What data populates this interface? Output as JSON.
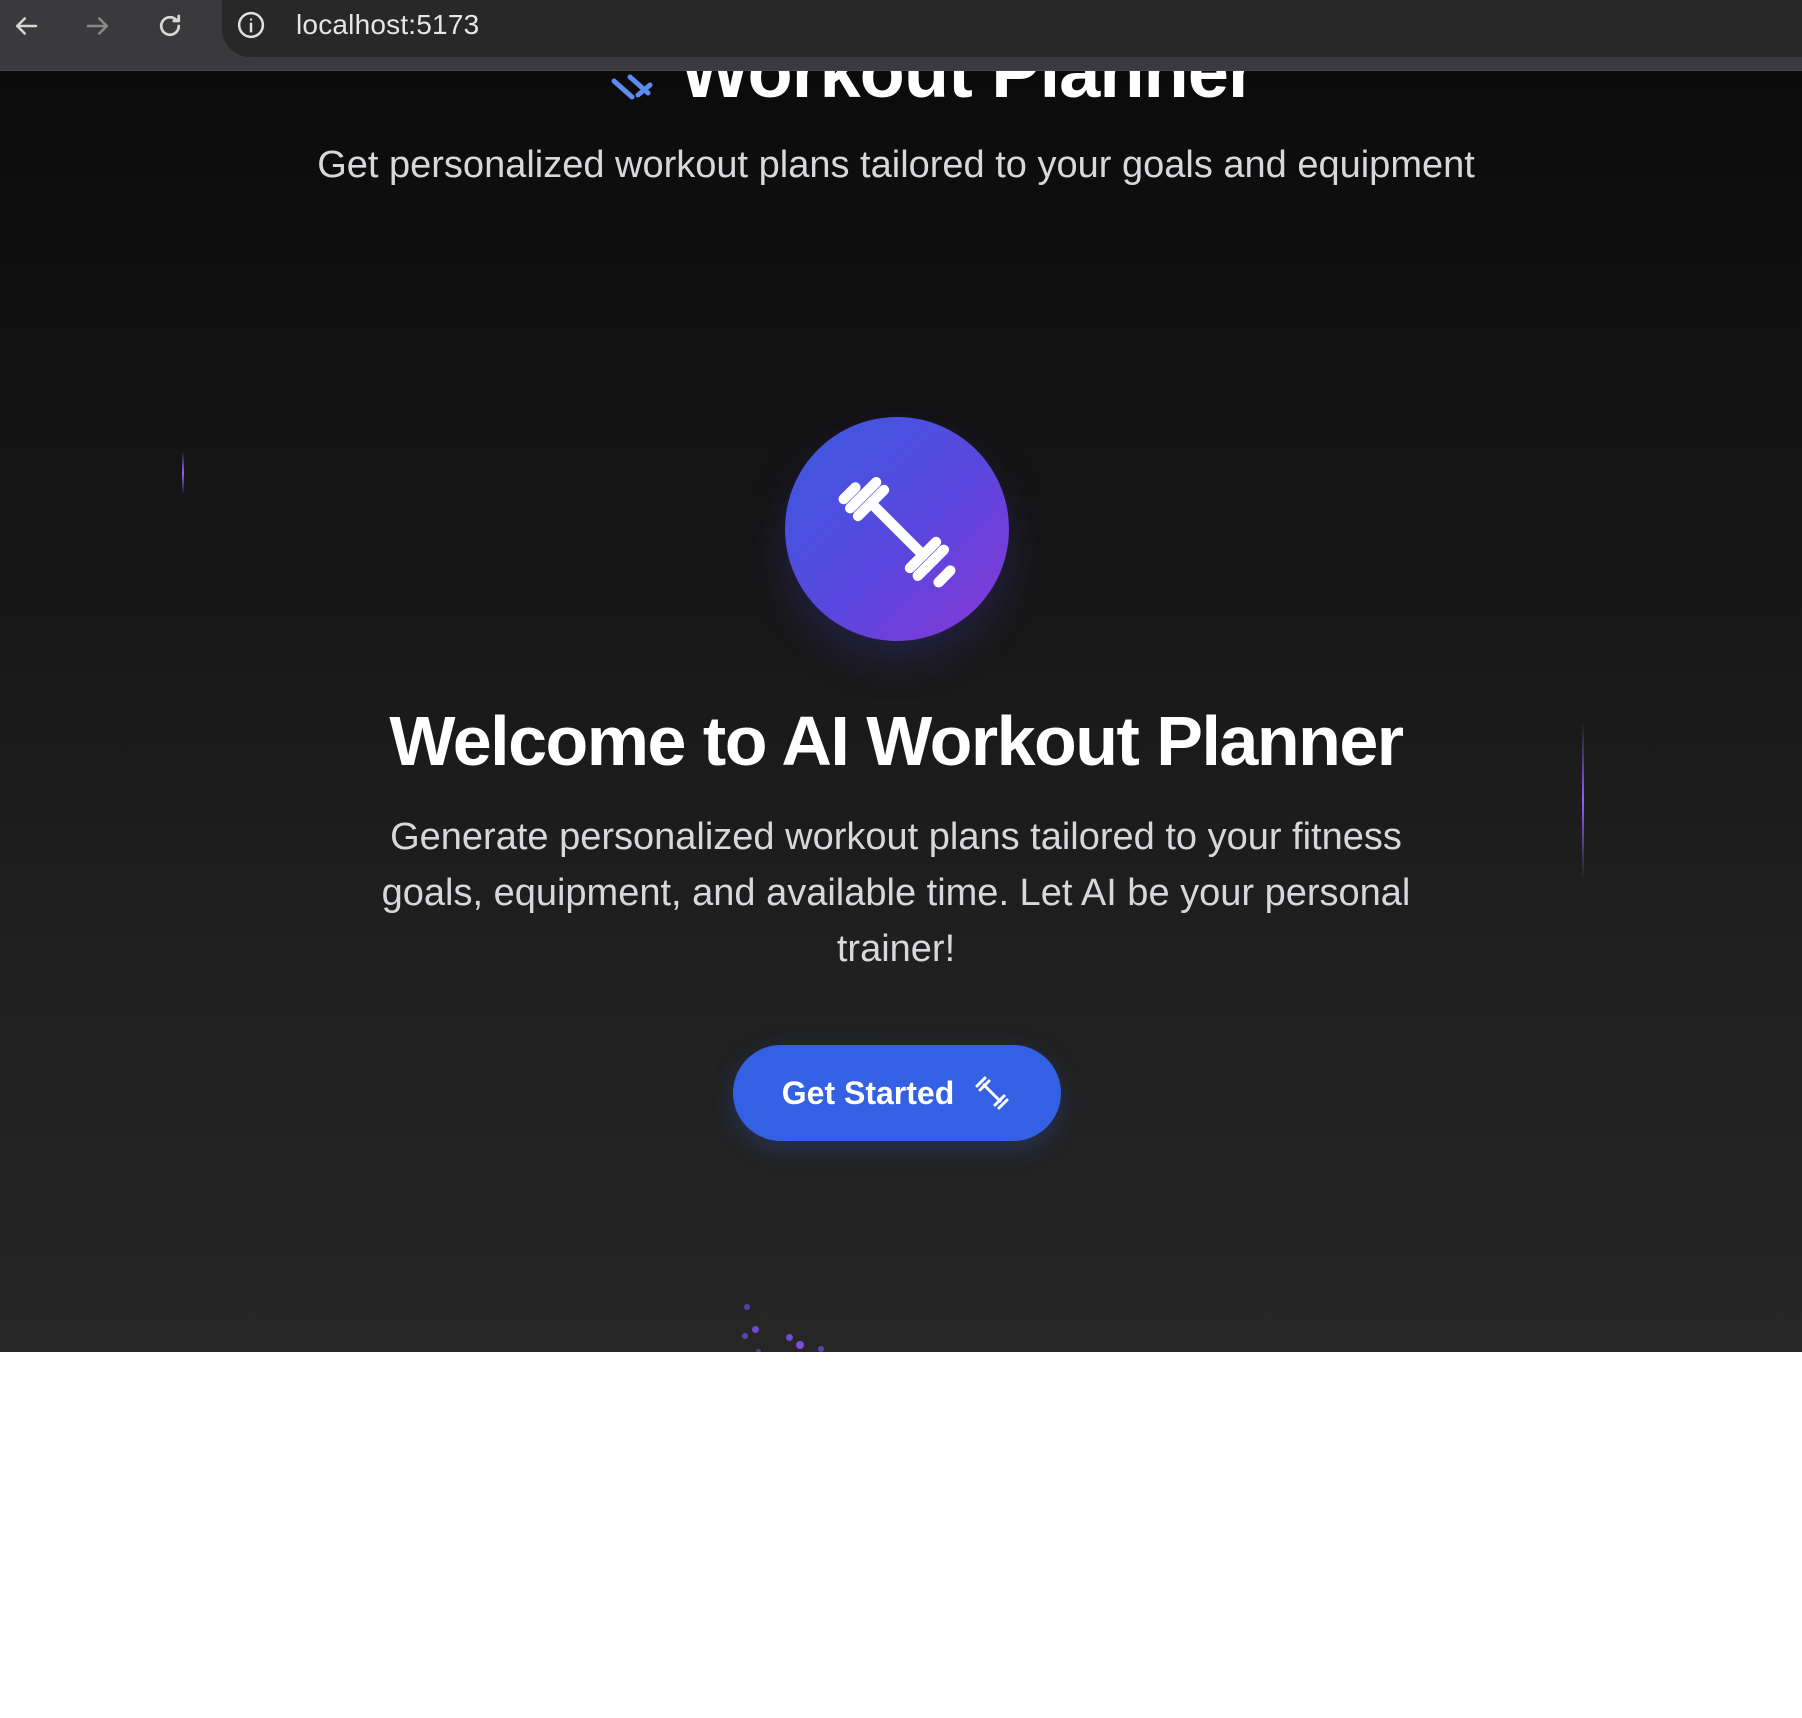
{
  "browser": {
    "url": "localhost:5173",
    "icons": {
      "back": "arrow-left-icon",
      "forward": "arrow-right-icon",
      "reload": "reload-icon",
      "site_info": "info-icon"
    }
  },
  "header": {
    "title": "Workout Planner",
    "subtitle": "Get personalized workout plans tailored to your goals and equipment",
    "icon": "dumbbell-icon"
  },
  "hero": {
    "icon": "dumbbell-icon",
    "heading": "Welcome to AI Workout Planner",
    "description": "Generate personalized workout plans tailored to your fitness goals, equipment, and available time. Let AI be your personal trainer!",
    "cta_label": "Get Started",
    "cta_icon": "dumbbell-icon"
  },
  "colors": {
    "accent": "#3461e4",
    "circle_gradient_start": "#3a5be0",
    "circle_gradient_end": "#8a36d6",
    "background_top": "#0b0b0b",
    "background_bottom": "#262626"
  }
}
